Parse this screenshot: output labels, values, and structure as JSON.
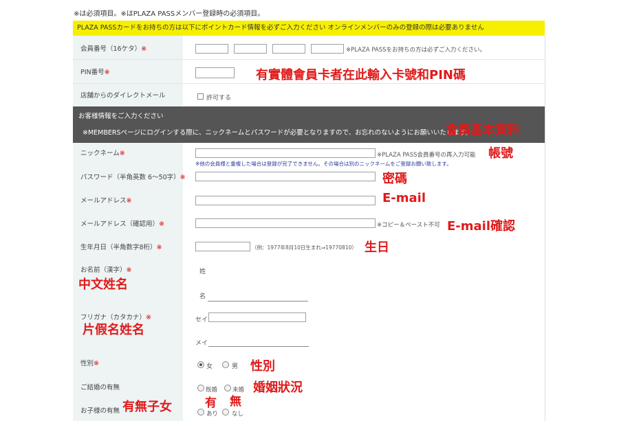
{
  "form": {
    "top_note": "※は必須項目。※はPLAZA PASSメンバー登録時の必須項目。",
    "yellow_notice": "PLAZA PASSカードをお持ちの方は以下にポイントカード情報を必ずご入力ください オンラインメンバーのみの登録の際は必要ありません",
    "card_number_label": "会員番号（16ケタ）",
    "card_number_note": "※PLAZA PASSをお持ちの方は必ずご入力ください。",
    "pin_label": "PIN番号",
    "direct_mail_label": "店舗からのダイレクトメール",
    "direct_mail_option": "許可する",
    "customer_section_title": "お客様情報をご入力ください",
    "customer_section_msg": "※MEMBERSページにログインする際に、ニックネームとパスワードが必要となりますので、お忘れのないようにお願いいたします。",
    "nickname_label": "ニックネーム",
    "nickname_note": "※PLAZA PASS会員番号の再入力可能",
    "nickname_note2": "※他の会員様と重複した場合は登録が完了できません。その場合は別のニックネームをご登録お願い致します。",
    "password_label": "パスワード（半角英数 6〜50字）",
    "email_label": "メールアドレス",
    "email_confirm_label": "メールアドレス（確認用）",
    "email_confirm_note": "※コピー＆ペースト不可",
    "birthday_label": "生年月日（半角数字8桁）",
    "birthday_note": "（例：1977年8月10日生まれ⇒19770810）",
    "name_label": "お名前（漢字）",
    "last_name": "姓",
    "first_name": "名",
    "kana_label": "フリガナ（カタカナ）",
    "kana_last": "セイ",
    "kana_first": "メイ",
    "gender_label": "性別",
    "gender_female": "女",
    "gender_male": "男",
    "marriage_label": "ご結婚の有無",
    "marriage_yes": "既婚",
    "marriage_no": "未婚",
    "children_label": "お子様の有無",
    "children_yes": "あり",
    "children_no": "なし",
    "required_mark": "※"
  },
  "annotations": {
    "card_pin": "有實體會員卡者在此輸入卡號和PIN碼",
    "basic_info": "會員基本資料",
    "account": "帳號",
    "password": "密碼",
    "email": "E-mail",
    "email_confirm": "E-mail確認",
    "birthday": "生日",
    "chinese_name": "中文姓名",
    "kana_name": "片假名姓名",
    "gender": "性別",
    "marriage": "婚姻狀況",
    "children": "有無子女",
    "yes": "有",
    "no": "無"
  },
  "colors": {
    "annotation": "#e01a1a",
    "yellow": "#f6f000",
    "dark_bar": "#555555",
    "left_col": "#eef3f4"
  }
}
